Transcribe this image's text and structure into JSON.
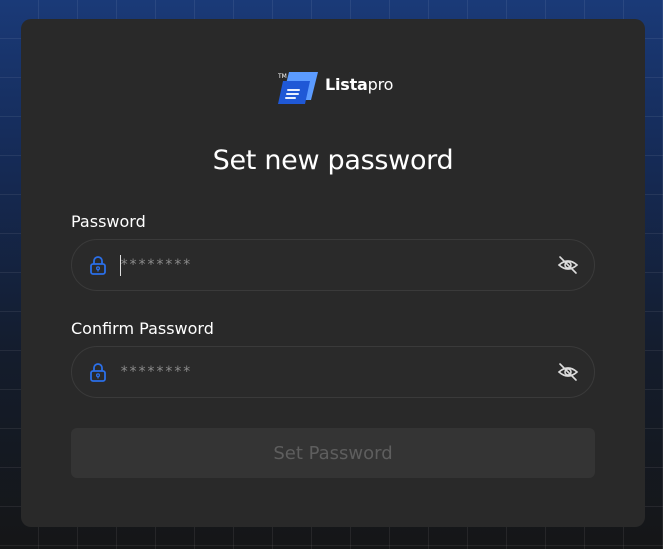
{
  "brand": {
    "name_bold": "Lista",
    "name_light": "pro",
    "mark": "TM",
    "logo_icon": "document-list-icon",
    "accent_color": "#2b6fe8"
  },
  "title": "Set new password",
  "password_field": {
    "label": "Password",
    "placeholder": "********",
    "value": "",
    "leading_icon": "lock-icon",
    "trailing_icon": "eye-off-icon"
  },
  "confirm_field": {
    "label": "Confirm Password",
    "placeholder": "********",
    "value": "",
    "leading_icon": "lock-icon",
    "trailing_icon": "eye-off-icon"
  },
  "submit": {
    "label": "Set Password",
    "disabled": true
  }
}
